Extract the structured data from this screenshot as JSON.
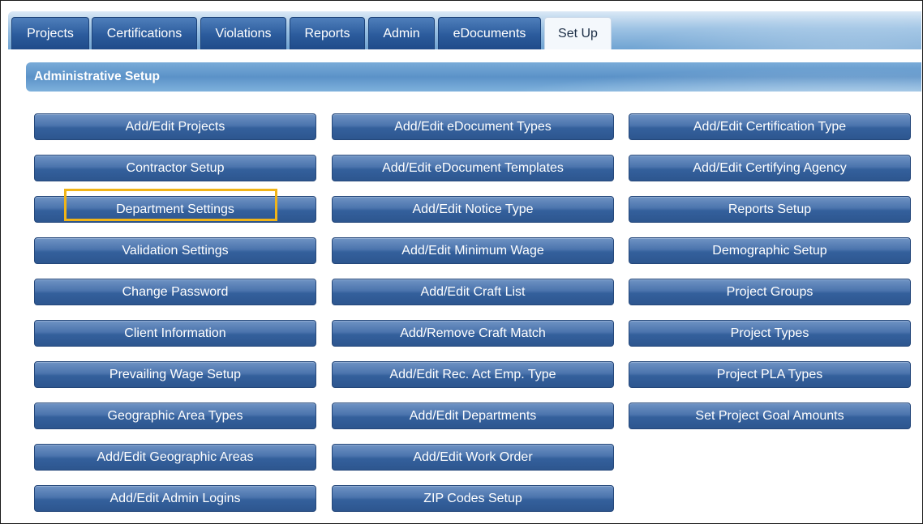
{
  "tabs": [
    {
      "label": "Projects",
      "active": false
    },
    {
      "label": "Certifications",
      "active": false
    },
    {
      "label": "Violations",
      "active": false
    },
    {
      "label": "Reports",
      "active": false
    },
    {
      "label": "Admin",
      "active": false
    },
    {
      "label": "eDocuments",
      "active": false
    },
    {
      "label": "Set Up",
      "active": true
    }
  ],
  "section": {
    "title": "Administrative Setup"
  },
  "columns": [
    [
      "Add/Edit Projects",
      "Contractor Setup",
      "Department Settings",
      "Validation Settings",
      "Change Password",
      "Client Information",
      "Prevailing Wage Setup",
      "Geographic Area Types",
      "Add/Edit Geographic Areas",
      "Add/Edit Admin Logins"
    ],
    [
      "Add/Edit eDocument Types",
      "Add/Edit eDocument Templates",
      "Add/Edit Notice Type",
      "Add/Edit Minimum Wage",
      "Add/Edit Craft List",
      "Add/Remove Craft Match",
      "Add/Edit Rec. Act Emp. Type",
      "Add/Edit Departments",
      "Add/Edit Work Order",
      "ZIP Codes Setup"
    ],
    [
      "Add/Edit Certification Type",
      "Add/Edit Certifying Agency",
      "Reports Setup",
      "Demographic Setup",
      "Project Groups",
      "Project Types",
      "Project PLA Types",
      "Set Project Goal Amounts"
    ]
  ],
  "highlighted": "Department Settings",
  "colors": {
    "highlight": "#f0b418",
    "button": "#34609c",
    "header": "#5b92c8"
  }
}
